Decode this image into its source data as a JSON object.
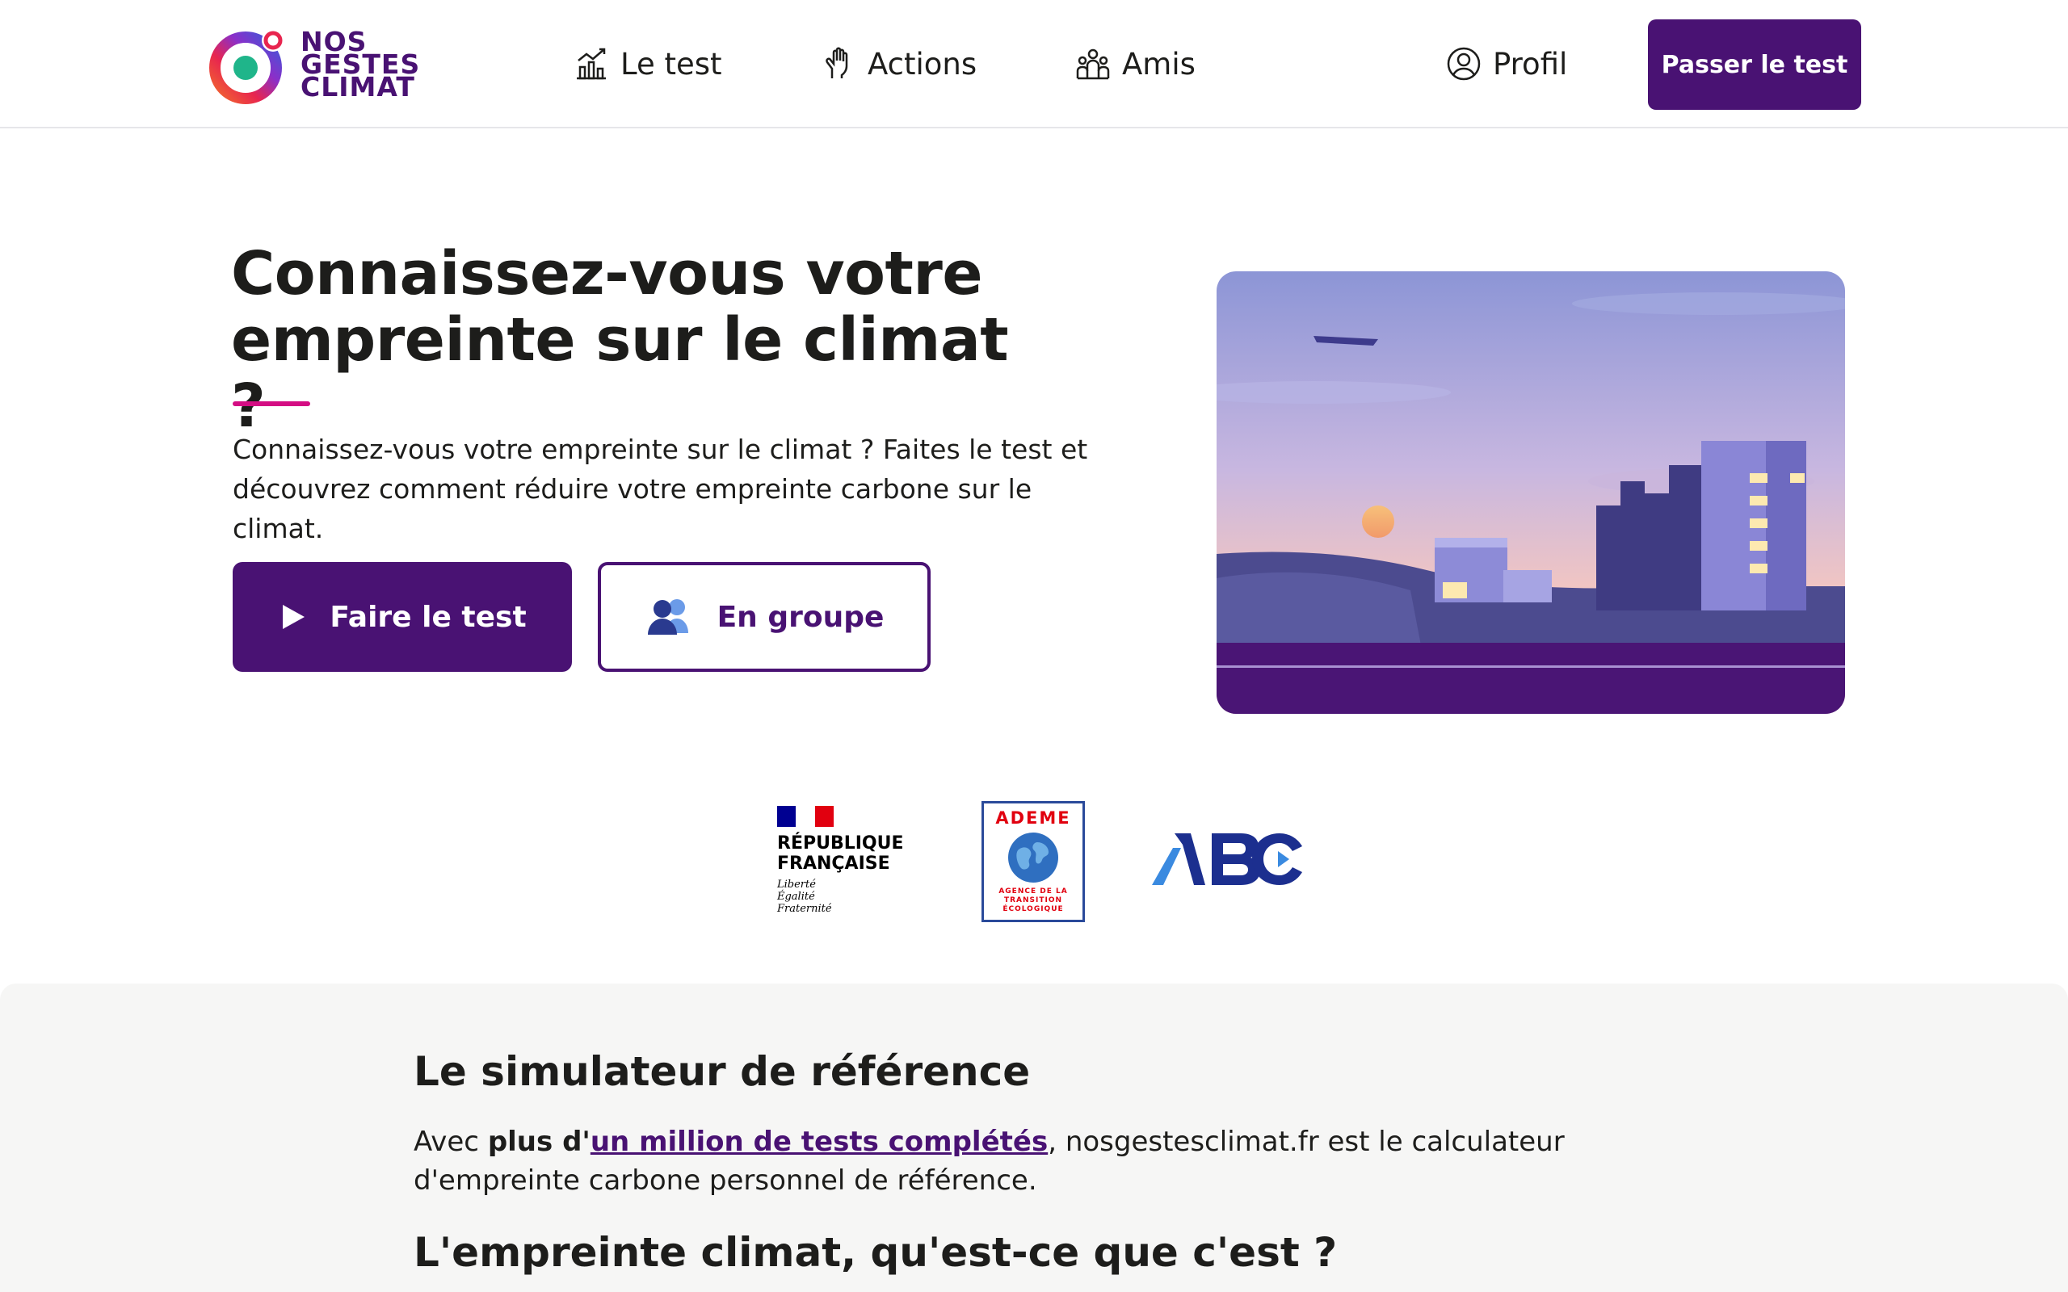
{
  "header": {
    "logo_lines": [
      "NOS",
      "GESTES",
      "CLIMAT"
    ],
    "nav": {
      "test": "Le test",
      "actions": "Actions",
      "amis": "Amis",
      "profil": "Profil"
    },
    "cta": "Passer le test"
  },
  "hero": {
    "title": "Connaissez-vous votre empreinte sur le climat ?",
    "description": "Connaissez-vous votre empreinte sur le climat ? Faites le test et découvrez comment réduire votre empreinte carbone sur le climat.",
    "primary_button": "Faire le test",
    "secondary_button": "En groupe"
  },
  "partners": {
    "rf_lines": [
      "RÉPUBLIQUE",
      "FRANÇAISE"
    ],
    "rf_motto": [
      "Liberté",
      "Égalité",
      "Fraternité"
    ],
    "ademe_name": "ADEME",
    "ademe_sub": [
      "AGENCE DE LA",
      "TRANSITION",
      "ÉCOLOGIQUE"
    ],
    "abc": "ABC"
  },
  "section": {
    "title": "Le simulateur de référence",
    "text_prefix": "Avec ",
    "text_bold": "plus d'",
    "text_link": "un million de tests complétés",
    "text_suffix": ", nosgestesclimat.fr est le calculateur d'empreinte carbone personnel de référence.",
    "title2": "L'empreinte climat, qu'est-ce que c'est ?"
  },
  "colors": {
    "brand": "#491273",
    "accent": "#d40d83",
    "gray_bg": "#f6f6f5"
  },
  "icons": [
    "logo-icon",
    "chart-icon",
    "hand-icon",
    "group-icon",
    "user-circle-icon",
    "play-icon",
    "users-icon"
  ]
}
